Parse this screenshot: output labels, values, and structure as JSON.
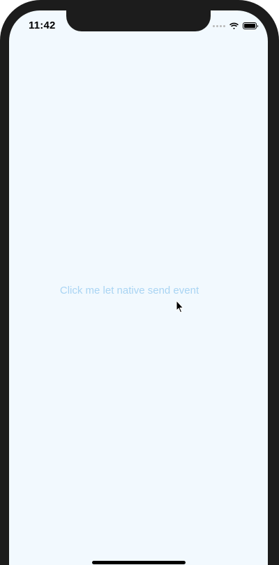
{
  "status_bar": {
    "time": "11:42",
    "icons": [
      "signal-dots-icon",
      "wifi-icon",
      "battery-icon"
    ],
    "battery_level": 1.0
  },
  "main": {
    "link_text": "Click me let native send event",
    "link_color": "#a9d4f3",
    "background": "#f2f9fe"
  }
}
